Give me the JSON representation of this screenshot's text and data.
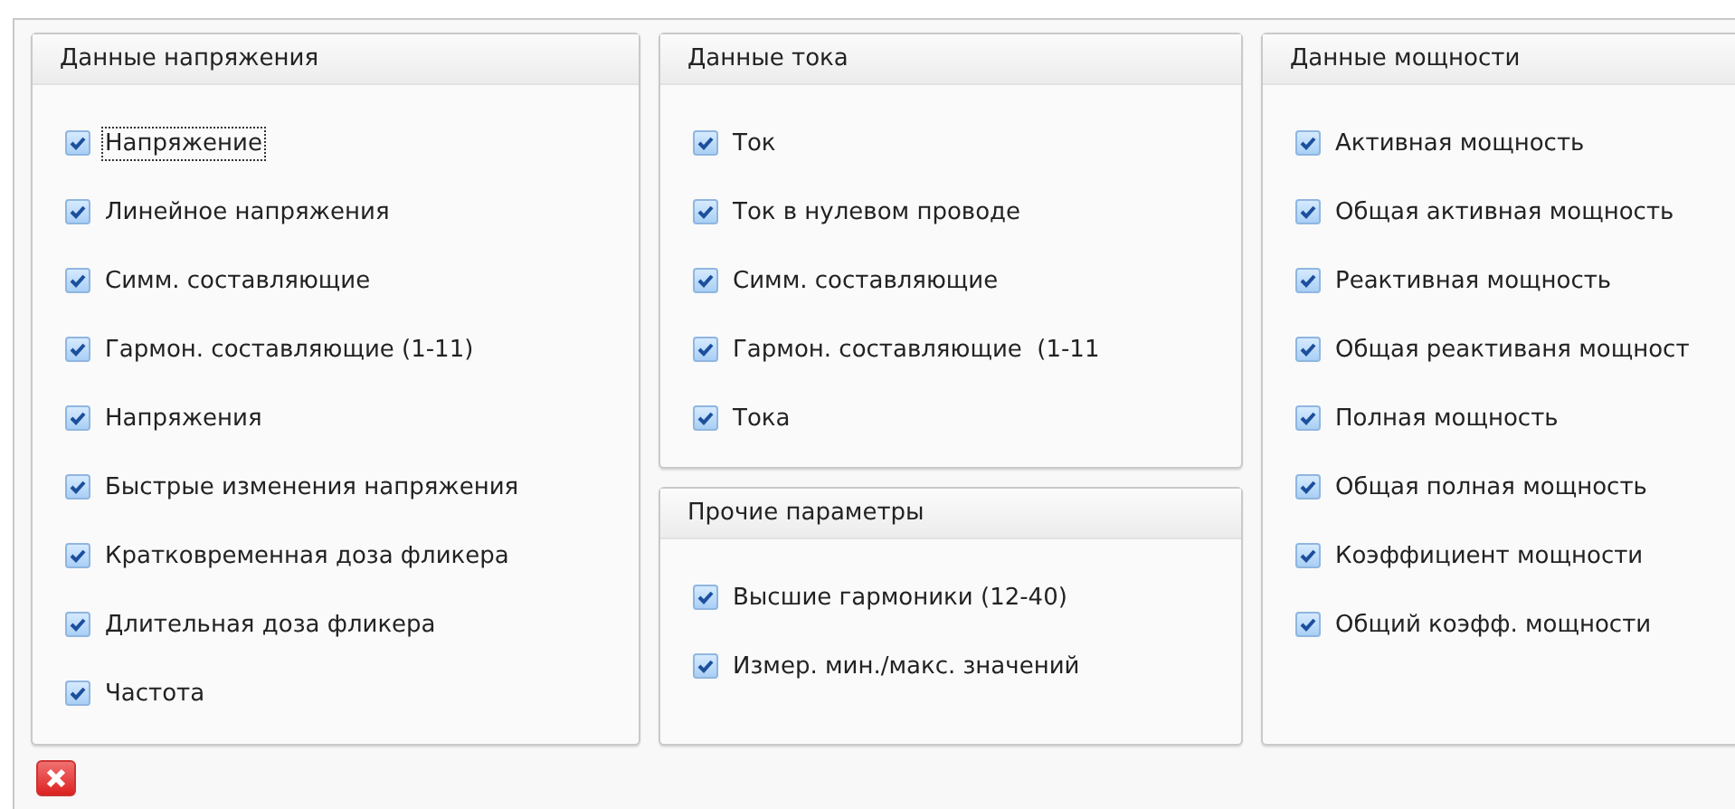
{
  "columns": [
    {
      "groups": [
        {
          "title": "Данные напряжения",
          "items": [
            {
              "label": "Напряжение",
              "checked": true,
              "focused": true
            },
            {
              "label": "Линейное напряжения",
              "checked": true,
              "focused": false
            },
            {
              "label": "Симм. составляющие",
              "checked": true,
              "focused": false
            },
            {
              "label": "Гармон. составляющие (1-11)",
              "checked": true,
              "focused": false
            },
            {
              "label": "Напряжения",
              "checked": true,
              "focused": false
            },
            {
              "label": "Быстрые изменения напряжения",
              "checked": true,
              "focused": false
            },
            {
              "label": "Кратковременная доза фликера",
              "checked": true,
              "focused": false
            },
            {
              "label": "Длительная доза фликера",
              "checked": true,
              "focused": false
            },
            {
              "label": "Частота",
              "checked": true,
              "focused": false
            }
          ]
        }
      ]
    },
    {
      "groups": [
        {
          "title": "Данные тока",
          "items": [
            {
              "label": "Ток",
              "checked": true,
              "focused": false
            },
            {
              "label": "Ток в нулевом проводе",
              "checked": true,
              "focused": false
            },
            {
              "label": "Симм. составляющие",
              "checked": true,
              "focused": false
            },
            {
              "label": "Гармон. составляющие  (1-11",
              "checked": true,
              "focused": false
            },
            {
              "label": "Тока",
              "checked": true,
              "focused": false
            }
          ]
        },
        {
          "title": "Прочие параметры",
          "items": [
            {
              "label": "Высшие гармоники (12-40)",
              "checked": true,
              "focused": false
            },
            {
              "label": "Измер. мин./макс. значений",
              "checked": true,
              "focused": false
            }
          ]
        }
      ]
    },
    {
      "groups": [
        {
          "title": "Данные мощности",
          "items": [
            {
              "label": "Активная мощность",
              "checked": true,
              "focused": false
            },
            {
              "label": "Общая активная мощность",
              "checked": true,
              "focused": false
            },
            {
              "label": "Реактивная мощность",
              "checked": true,
              "focused": false
            },
            {
              "label": "Общая реактиваня мощност",
              "checked": true,
              "focused": false
            },
            {
              "label": "Полная мощность",
              "checked": true,
              "focused": false
            },
            {
              "label": "Общая полная мощность",
              "checked": true,
              "focused": false
            },
            {
              "label": "Коэффициент мощности",
              "checked": true,
              "focused": false
            },
            {
              "label": "Общий коэфф. мощности",
              "checked": true,
              "focused": false
            }
          ]
        }
      ]
    }
  ]
}
